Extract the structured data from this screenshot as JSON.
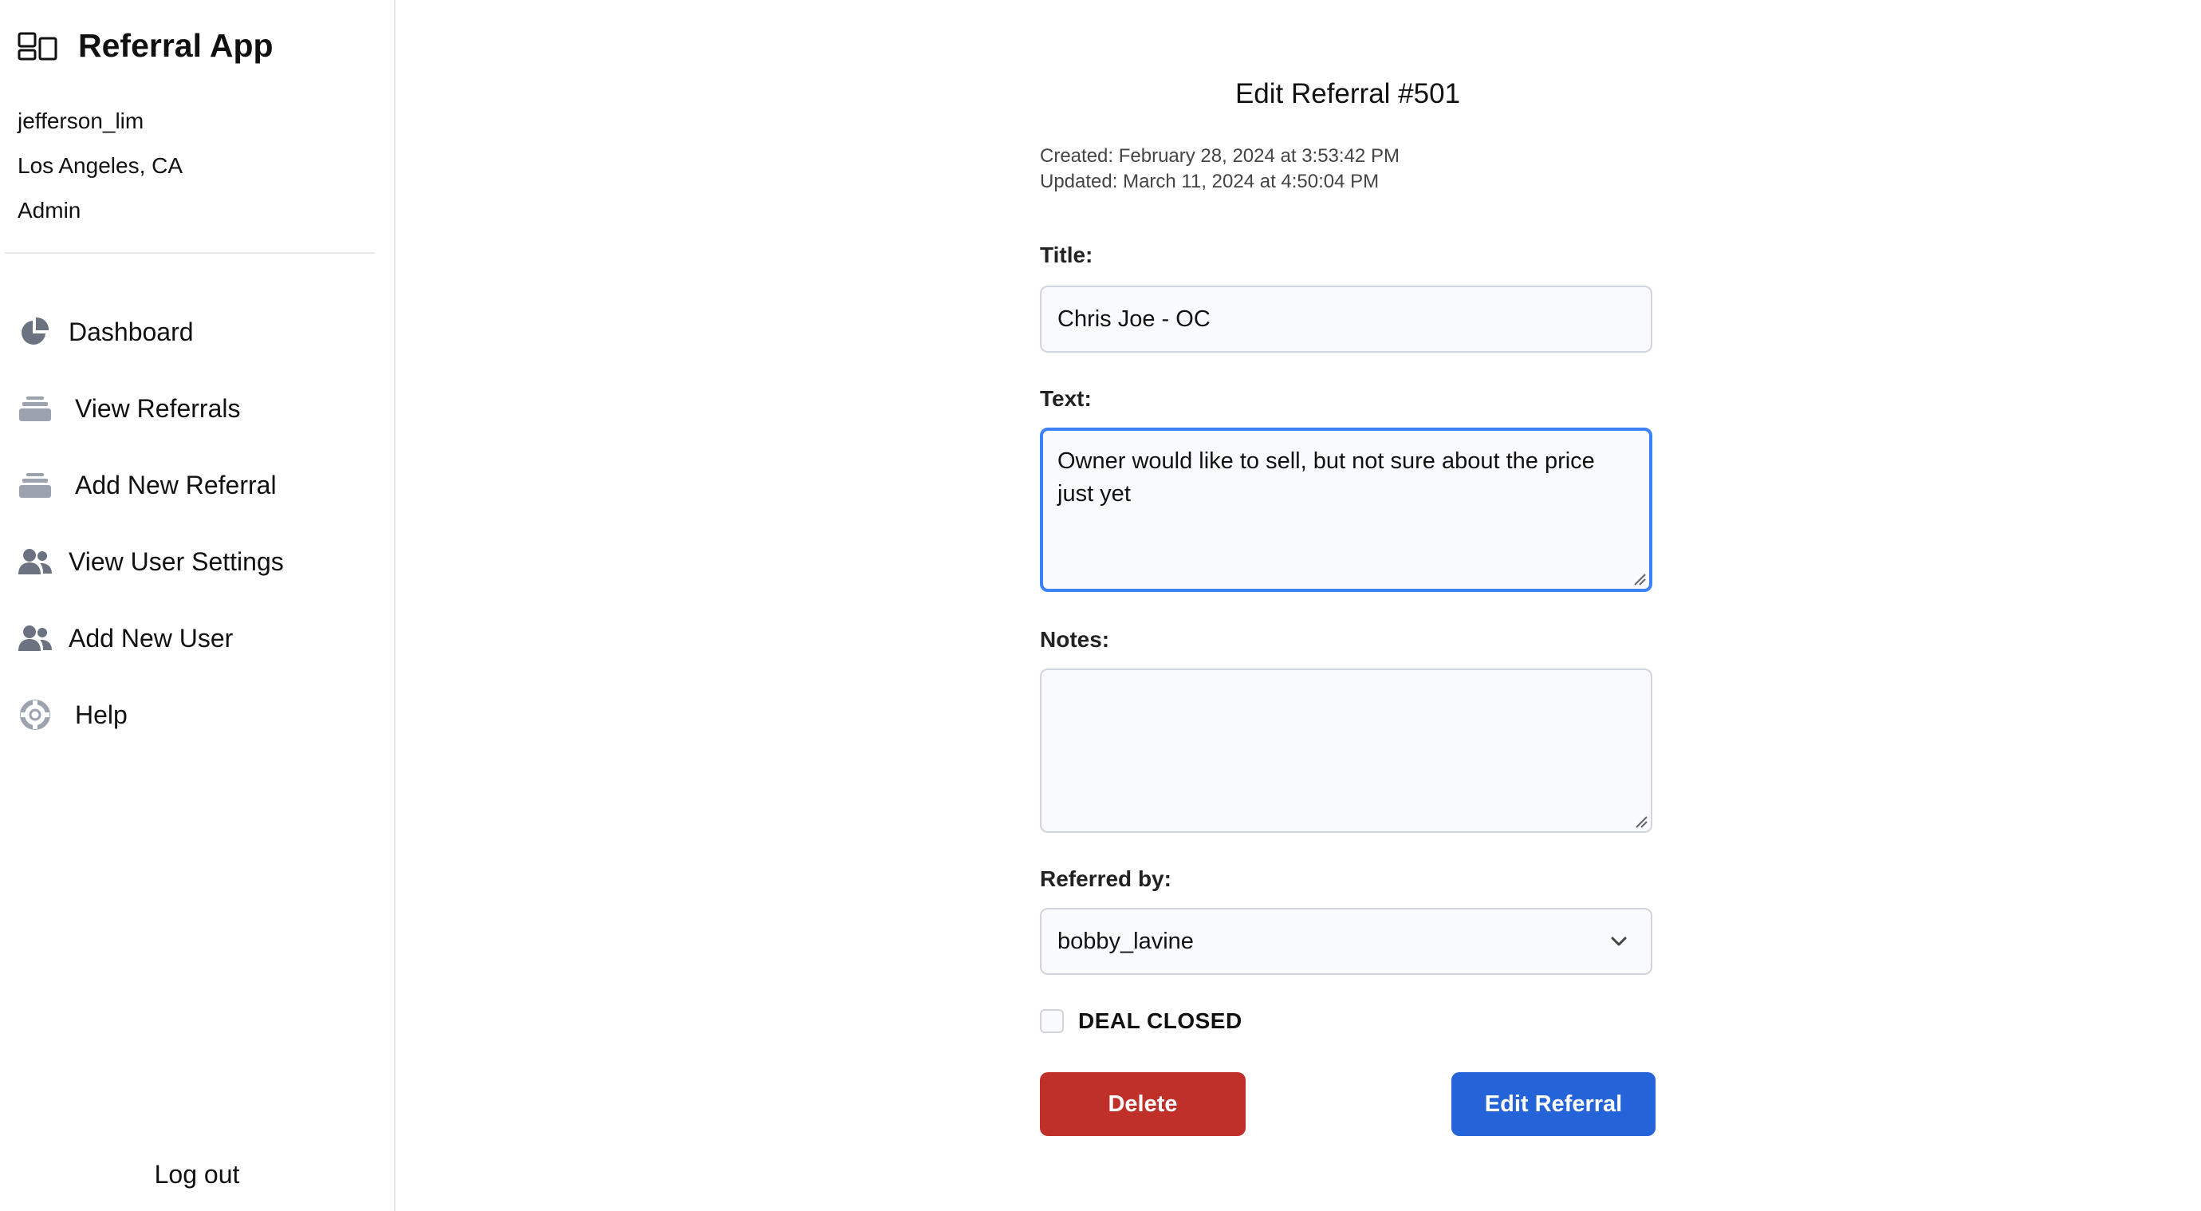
{
  "app": {
    "title": "Referral App"
  },
  "user": {
    "username": "jefferson_lim",
    "location": "Los Angeles, CA",
    "role": "Admin"
  },
  "nav": {
    "items": [
      {
        "label": "Dashboard",
        "icon": "pie-chart-icon"
      },
      {
        "label": "View Referrals",
        "icon": "inbox-stack-icon"
      },
      {
        "label": "Add New Referral",
        "icon": "inbox-stack-icon"
      },
      {
        "label": "View User Settings",
        "icon": "users-icon"
      },
      {
        "label": "Add New User",
        "icon": "users-icon"
      },
      {
        "label": "Help",
        "icon": "lifebuoy-icon"
      }
    ],
    "logout_label": "Log out"
  },
  "form": {
    "heading": "Edit Referral #501",
    "created": "Created: February 28, 2024 at 3:53:42 PM",
    "updated": "Updated: March 11, 2024 at 4:50:04 PM",
    "title_label": "Title:",
    "title_value": "Chris Joe - OC",
    "text_label": "Text:",
    "text_value": "Owner would like to sell, but not sure about the price just yet",
    "notes_label": "Notes:",
    "notes_value": "",
    "referred_by_label": "Referred by:",
    "referred_by_value": "bobby_lavine",
    "deal_closed_label": "DEAL CLOSED",
    "deal_closed_checked": false,
    "delete_label": "Delete",
    "submit_label": "Edit Referral"
  },
  "colors": {
    "delete": "#c0302a",
    "primary": "#2563d9",
    "focus": "#3b82f6",
    "icon": "#6b7280"
  }
}
